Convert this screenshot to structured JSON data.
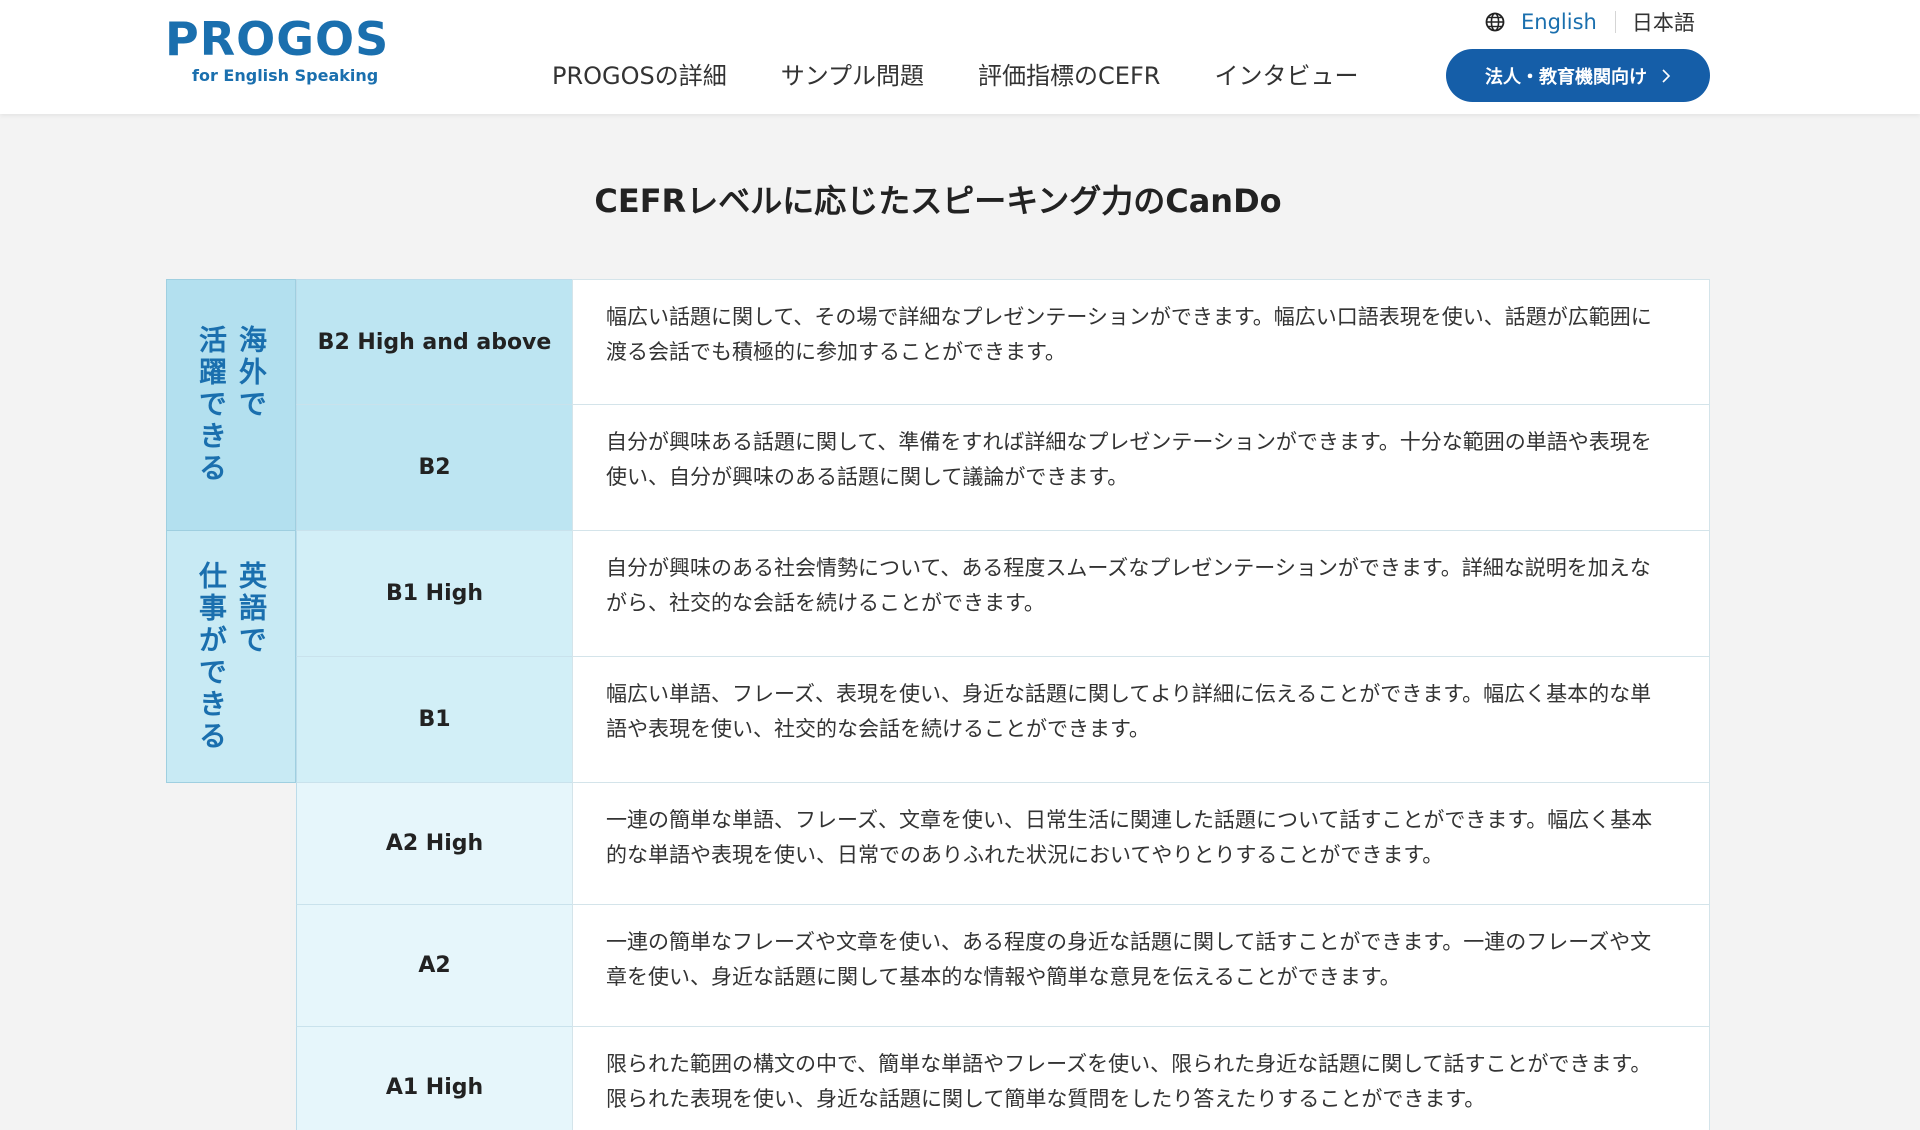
{
  "header": {
    "logo": {
      "main": "PROGOS",
      "sub": "for English Speaking"
    },
    "language": {
      "icon": "globe-icon",
      "english": "English",
      "japanese": "日本語"
    },
    "nav": [
      "PROGOSの詳細",
      "サンプル問題",
      "評価指標のCEFR",
      "インタビュー"
    ],
    "cta": {
      "label": "法人・教育機関向け",
      "icon": "chevron-right-icon"
    }
  },
  "page_title": "CEFRレベルに応じたスピーキング力のCanDo",
  "groups": [
    {
      "label": "海外で\n活躍できる"
    },
    {
      "label": "英語で\n仕事ができる"
    }
  ],
  "rows": [
    {
      "level": "B2 High and above",
      "description": "幅広い話題に関して、その場で詳細なプレゼンテーションができます。幅広い口語表現を使い、話題が広範囲に渡る会話でも積極的に参加することができます。"
    },
    {
      "level": "B2",
      "description": "自分が興味ある話題に関して、準備をすれば詳細なプレゼンテーションができます。十分な範囲の単語や表現を使い、自分が興味のある話題に関して議論ができます。"
    },
    {
      "level": "B1 High",
      "description": "自分が興味のある社会情勢について、ある程度スムーズなプレゼンテーションができます。詳細な説明を加えながら、社交的な会話を続けることができます。"
    },
    {
      "level": "B1",
      "description": "幅広い単語、フレーズ、表現を使い、身近な話題に関してより詳細に伝えることができます。幅広く基本的な単語や表現を使い、社交的な会話を続けることができます。"
    },
    {
      "level": "A2 High",
      "description": "一連の簡単な単語、フレーズ、文章を使い、日常生活に関連した話題について話すことができます。幅広く基本的な単語や表現を使い、日常でのありふれた状況においてやりとりすることができます。"
    },
    {
      "level": "A2",
      "description": "一連の簡単なフレーズや文章を使い、ある程度の身近な話題に関して話すことができます。一連のフレーズや文章を使い、身近な話題に関して基本的な情報や簡単な意見を伝えることができます。"
    },
    {
      "level": "A1 High",
      "description": "限られた範囲の構文の中で、簡単な単語やフレーズを使い、限られた身近な話題に関して話すことができます。限られた表現を使い、身近な話題に関して簡単な質問をしたり答えたりすることができます。"
    }
  ],
  "colors": {
    "brand_blue": "#1a6fae",
    "cta_blue": "#155ea8",
    "group_bg_top": "#b3e0ef",
    "group_bg_mid": "#c8eaf4",
    "level_bg_b2": "#bde5f2",
    "level_bg_b1": "#d2eff7",
    "level_bg_a": "#e6f6fb",
    "page_bg": "#f3f3f3"
  }
}
